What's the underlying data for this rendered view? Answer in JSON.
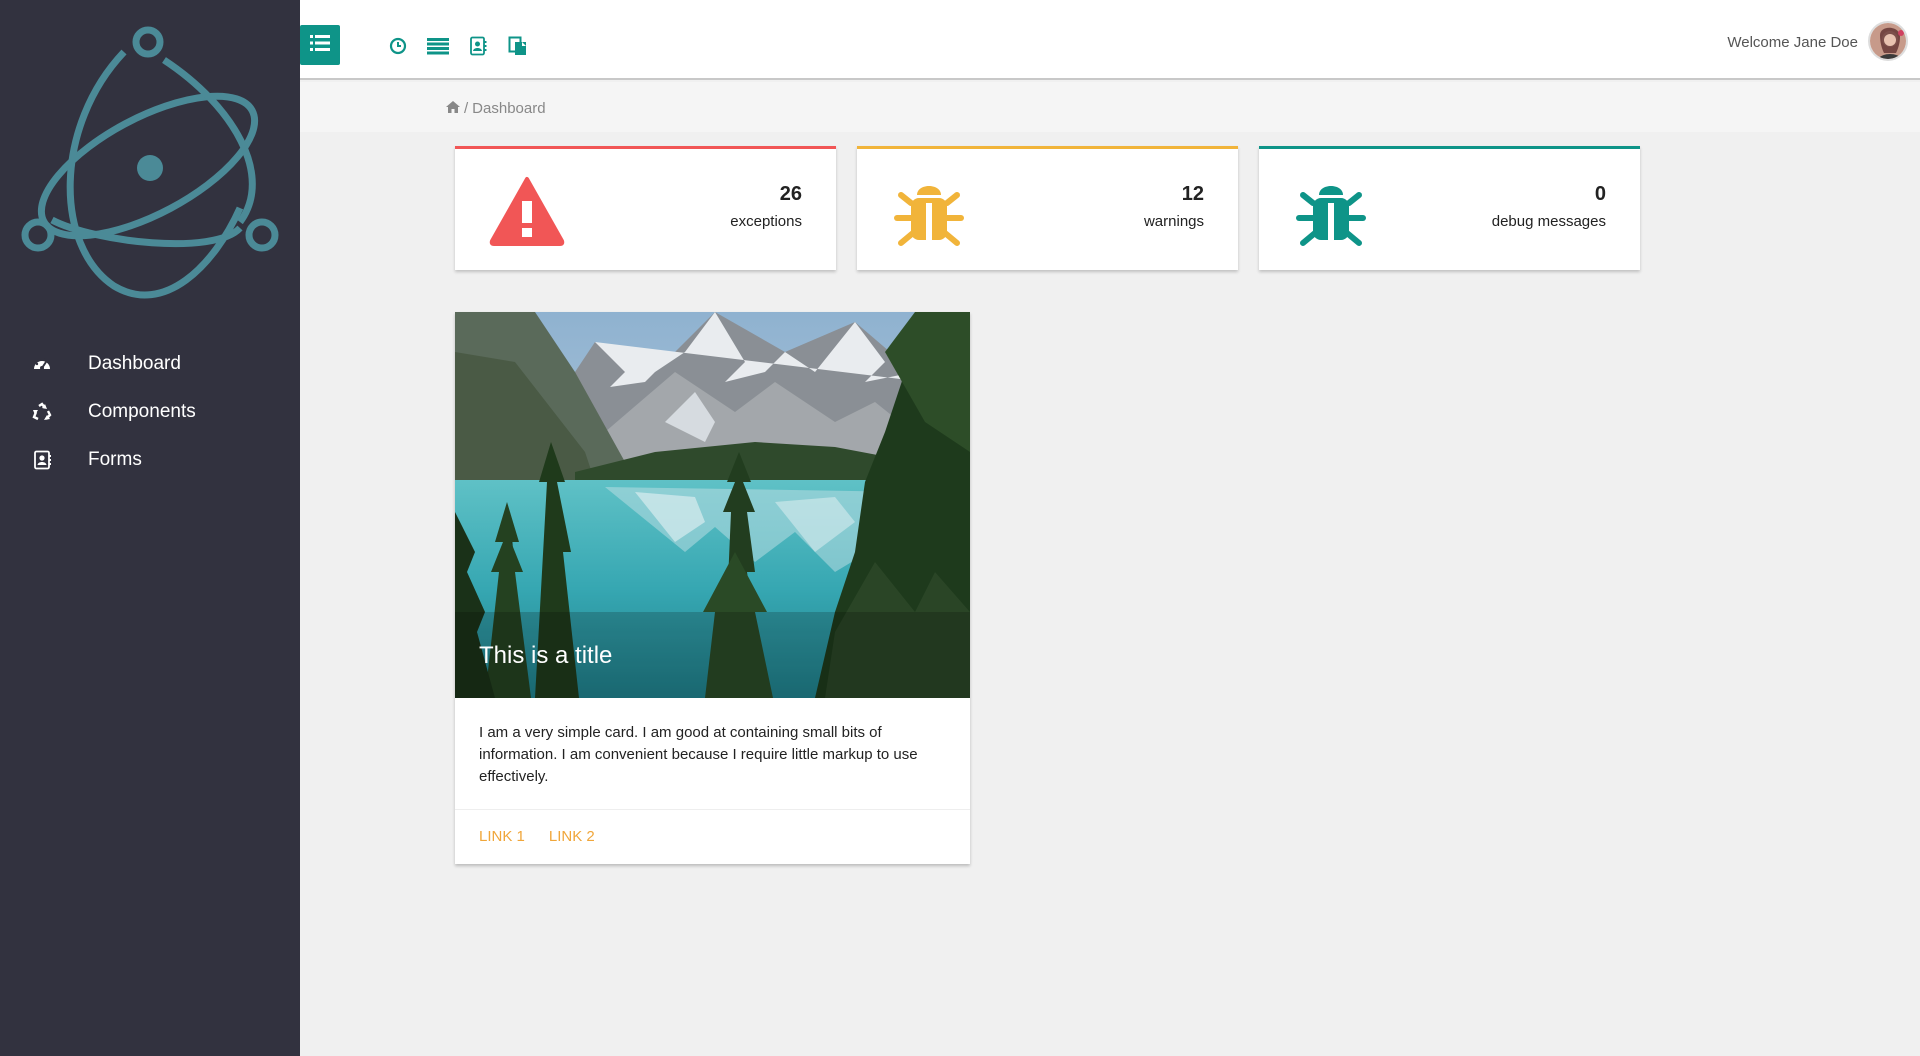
{
  "sidebar": {
    "items": [
      {
        "label": "Dashboard",
        "icon": "dashboard-icon"
      },
      {
        "label": "Components",
        "icon": "recycle-icon"
      },
      {
        "label": "Forms",
        "icon": "contact-book-icon"
      }
    ]
  },
  "topbar": {
    "menu_icon": "list-icon",
    "icons": [
      "clock-icon",
      "list-lines-icon",
      "contact-book-icon",
      "copy-icon"
    ],
    "welcome": "Welcome Jane Doe"
  },
  "breadcrumb": {
    "home_icon": "home-icon",
    "separator": "/",
    "current": "Dashboard"
  },
  "stats": [
    {
      "value": "26",
      "label": "exceptions",
      "icon": "warning-icon",
      "color": "#f15656"
    },
    {
      "value": "12",
      "label": "warnings",
      "icon": "bug-icon",
      "color": "#f1b43a"
    },
    {
      "value": "0",
      "label": "debug messages",
      "icon": "bug-icon",
      "color": "#0e9488"
    }
  ],
  "card": {
    "title": "This is a title",
    "text": "I am a very simple card. I am good at containing small bits of information. I am convenient because I require little markup to use effectively.",
    "links": [
      "LINK 1",
      "LINK 2"
    ]
  },
  "colors": {
    "sidebar_bg": "#32323f",
    "accent": "#0e9488",
    "logo": "#4b8a97",
    "link": "#f0a63a"
  }
}
